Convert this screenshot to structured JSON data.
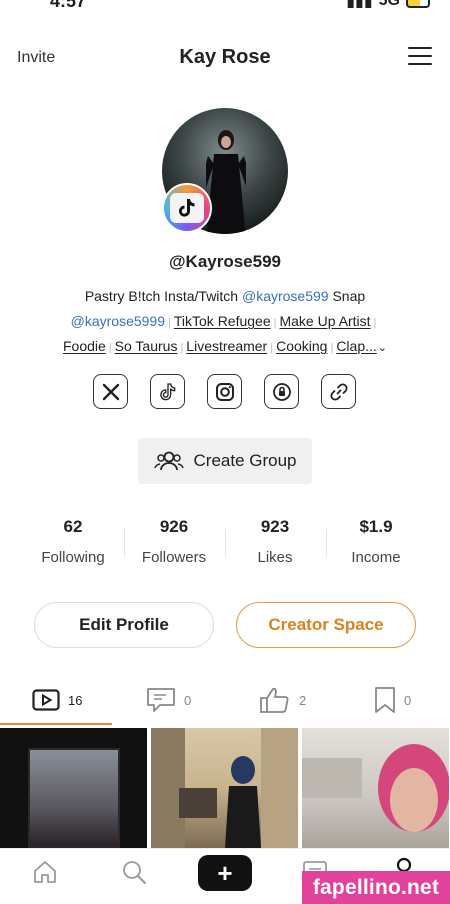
{
  "status": {
    "time": "4:57",
    "signal": "5G"
  },
  "header": {
    "invite_label": "Invite",
    "title": "Kay Rose"
  },
  "profile": {
    "handle": "@Kayrose599",
    "bio": {
      "line1_text": "Pastry B!tch Insta/Twitch ",
      "line1_link": "@kayrose599",
      "line1_tail": " Snap",
      "line2_link": "@kayrose5999",
      "line2_tags": [
        "TikTok Refugee",
        "Make Up Artist"
      ],
      "line3_tags": [
        "Foodie",
        "So Taurus",
        "Livestreamer",
        "Cooking",
        "Clap..."
      ]
    },
    "social_icons": [
      "x-icon",
      "tiktok-icon",
      "instagram-icon",
      "onlyfans-icon",
      "link-icon"
    ]
  },
  "create_group": {
    "label": "Create Group"
  },
  "stats": [
    {
      "value": "62",
      "label": "Following"
    },
    {
      "value": "926",
      "label": "Followers"
    },
    {
      "value": "923",
      "label": "Likes"
    },
    {
      "value": "$1.9",
      "label": "Income"
    }
  ],
  "buttons": {
    "edit_profile": "Edit Profile",
    "creator_space": "Creator Space"
  },
  "tabs": [
    {
      "icon": "video-icon",
      "count": "16"
    },
    {
      "icon": "comment-icon",
      "count": "0"
    },
    {
      "icon": "like-icon",
      "count": "2"
    },
    {
      "icon": "bookmark-icon",
      "count": "0"
    }
  ],
  "nav": {
    "plus": "+"
  },
  "watermark": {
    "text": "fapellino.net"
  },
  "colors": {
    "accent": "#e08a36",
    "link": "#3b6fb6",
    "watermark": "#e0429c"
  }
}
